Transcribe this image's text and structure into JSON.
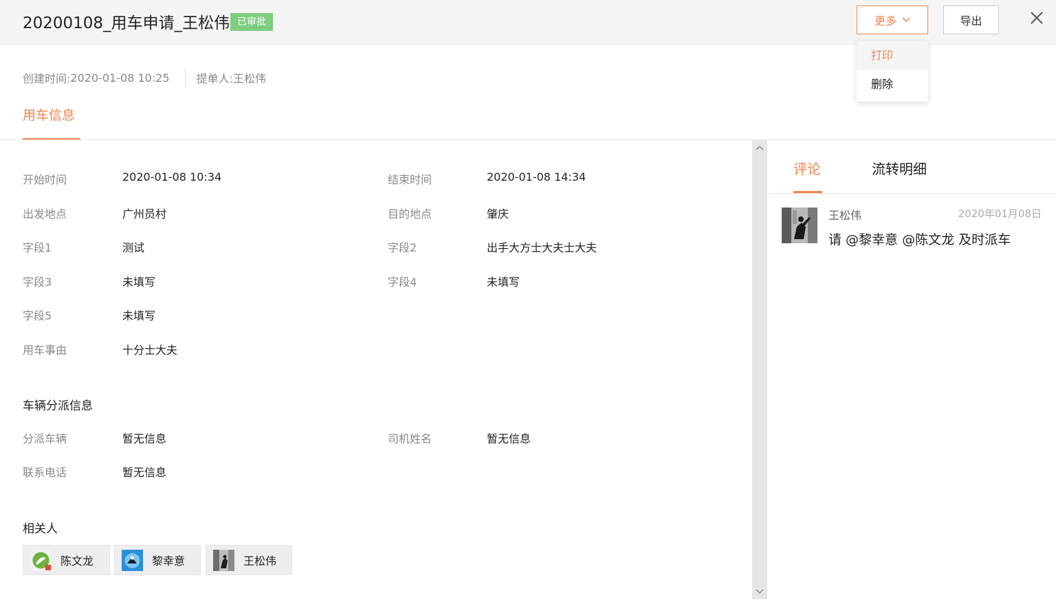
{
  "header": {
    "title": "20200108_用车申请_王松伟",
    "status_badge": "已审批",
    "more_label": "更多",
    "export_label": "导出"
  },
  "dropdown": {
    "items": [
      "打印",
      "删除"
    ],
    "active_index": 0
  },
  "meta": {
    "created_label": "创建时间:",
    "created_value": "2020-01-08 10:25",
    "submitter_label": "提单人:",
    "submitter_value": "王松伟"
  },
  "main_tab": "用车信息",
  "fields": [
    {
      "label": "开始时间",
      "value": "2020-01-08 10:34"
    },
    {
      "label": "结束时间",
      "value": "2020-01-08 14:34"
    },
    {
      "label": "出发地点",
      "value": "广州员村"
    },
    {
      "label": "目的地点",
      "value": "肇庆"
    },
    {
      "label": "字段1",
      "value": "测试"
    },
    {
      "label": "字段2",
      "value": "出手大方士大夫士大夫"
    },
    {
      "label": "字段3",
      "value": "未填写"
    },
    {
      "label": "字段4",
      "value": "未填写"
    },
    {
      "label": "字段5",
      "value": "未填写"
    },
    {
      "label": "用车事由",
      "value": "十分士大夫"
    }
  ],
  "dispatch": {
    "title": "车辆分派信息",
    "fields": [
      {
        "label": "分派车辆",
        "value": "暂无信息"
      },
      {
        "label": "司机姓名",
        "value": "暂无信息"
      },
      {
        "label": "联系电话",
        "value": "暂无信息"
      }
    ]
  },
  "related": {
    "title": "相关人",
    "people": [
      "陈文龙",
      "黎幸意",
      "王松伟"
    ]
  },
  "right_panel": {
    "tabs": [
      "评论",
      "流转明细"
    ],
    "active_tab": 0,
    "comment": {
      "author": "王松伟",
      "date": "2020年01月08日",
      "text": "请 @黎幸意 @陈文龙 及时派车"
    }
  },
  "colors": {
    "accent": "#f0844b",
    "badge_green": "#7fce7f",
    "header_bg": "#f5f5f5"
  },
  "icons": [
    "chevron-down-icon",
    "close-icon",
    "scroll-up-icon",
    "scroll-down-icon",
    "avatar"
  ]
}
